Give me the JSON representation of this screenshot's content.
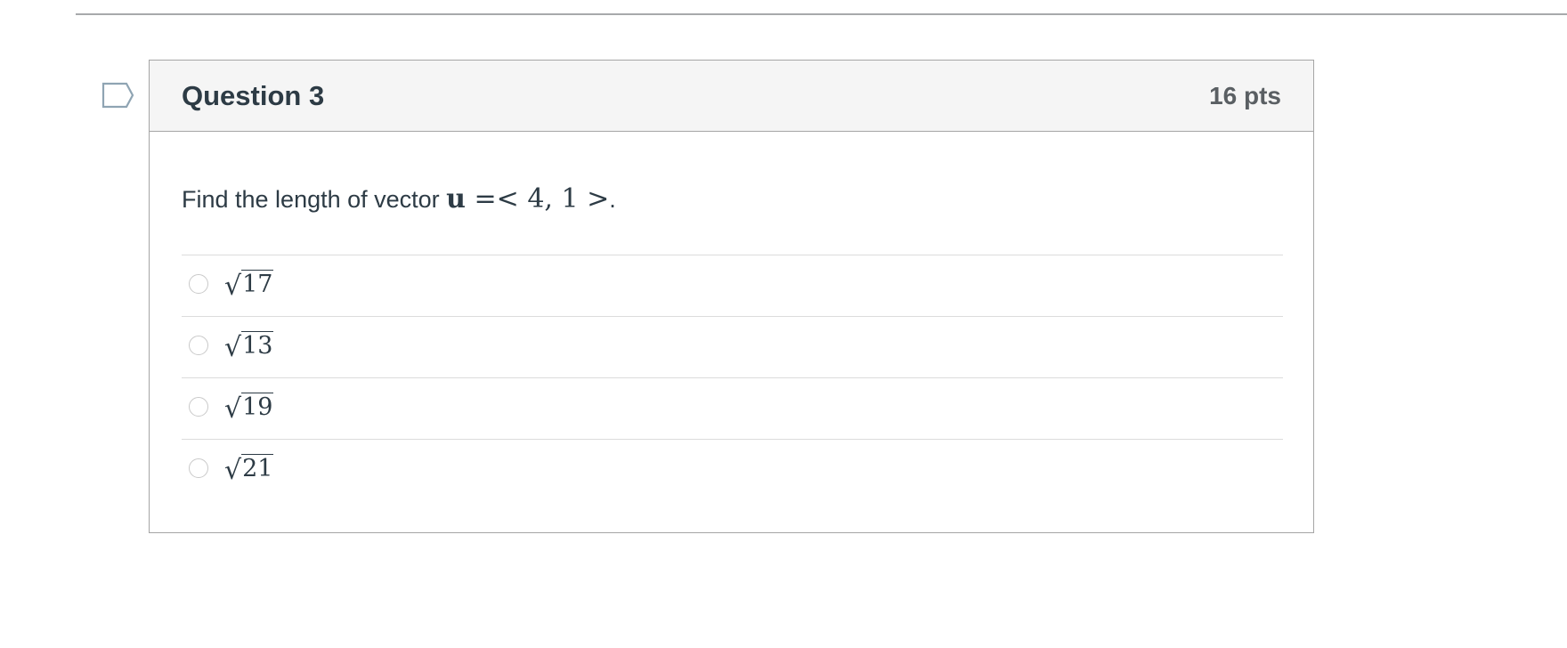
{
  "question": {
    "title": "Question 3",
    "points": "16 pts",
    "prompt_text": "Find the length of vector ",
    "vector_symbol": "u",
    "vector_expression": " =< 4, 1 >",
    "prompt_end": ".",
    "answers": [
      {
        "sqrt_symbol": "√",
        "radicand": "17"
      },
      {
        "sqrt_symbol": "√",
        "radicand": "13"
      },
      {
        "sqrt_symbol": "√",
        "radicand": "19"
      },
      {
        "sqrt_symbol": "√",
        "radicand": "21"
      }
    ]
  },
  "colors": {
    "header_background": "#f5f5f5",
    "border": "#a5a5a5",
    "text": "#2d3b45",
    "points_text": "#5a5f63",
    "flag_outline": "#8fa4b3"
  },
  "icons": {
    "flag": "bookmark-flag-icon"
  }
}
